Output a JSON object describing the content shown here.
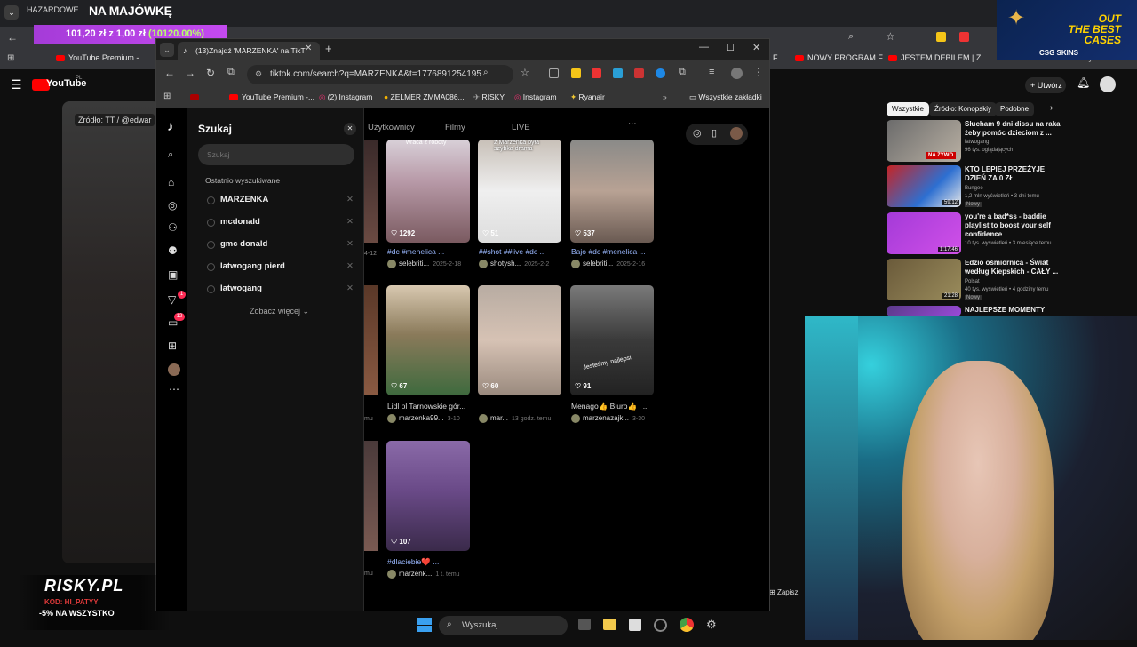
{
  "overlay": {
    "promo_title": "NA MAJÓWKĘ",
    "promo_odds_prefix": "101,20 zł",
    "promo_odds_mid": "z",
    "promo_odds_base": "1,00 zł",
    "promo_odds_pct": "(10120.00%)",
    "hazard_tab": "HAZARDOWE",
    "case_banner_line1": "OUT",
    "case_banner_line2": "THE BEST",
    "case_banner_line3": "CASES",
    "case_banner_brand": "CSG SKINS",
    "risky_logo": "RISKY.PL",
    "risky_code": "KOD: HI_PATYY",
    "risky_discount": "-5% NA WSZYSTKO"
  },
  "bg_browser": {
    "bookmarks": [
      "YouTube Premium -...",
      "F...",
      "NOWY PROGRAM F...",
      "JESTEM DEBILEM | Z...",
      "Wszystkie zakładki"
    ]
  },
  "youtube": {
    "logo": "YouTube",
    "logo_suffix": "PL",
    "source_label": "Źródło: TT / @edwar",
    "create_label": "Utwórz",
    "chips": [
      "Wszystkie",
      "Źródło: Konopskiy",
      "Podobne"
    ],
    "related": [
      {
        "title": "Słucham 9 dni dissu na raka żeby pomóc dzieciom z ...",
        "channel": "latwogang",
        "meta": "96 tys. oglądających",
        "badge": "NA ŻYWO"
      },
      {
        "title": "KTO LEPIEJ PRZEŻYJE DZIEŃ ZA 0 ZŁ",
        "channel": "Bungee",
        "meta": "1,2 mln wyświetleń • 3 dni temu",
        "duration": "59:12",
        "tag": "Nowy"
      },
      {
        "title": "you're a bad*ss - baddie playlist to boost your self confidence",
        "channel": "baddie femme",
        "meta": "10 tys. wyświetleń • 3 miesiące temu",
        "duration": "1:17:46"
      },
      {
        "title": "Edzio ośmiornica - Świat według Kiepskich - CAŁY ...",
        "channel": "Polsat",
        "meta": "40 tys. wyświetleń • 4 godziny temu",
        "duration": "21:28",
        "tag": "Nowy"
      },
      {
        "title": "NAJLEPSZE MOMENTY",
        "channel": "",
        "meta": "",
        "duration": ""
      }
    ],
    "save_label": "Zapisz"
  },
  "window": {
    "tab_title": "(13)Znajdź 'MARZENKA' na TikT",
    "url": "tiktok.com/search?q=MARZENKA&t=1776891254195",
    "bookmarks": [
      "YouTube Premium -...",
      "(2) Instagram",
      "ZELMER ZMMA086...",
      "RISKY",
      "Instagram",
      "Ryanair",
      "Wszystkie zakładki"
    ]
  },
  "tiktok": {
    "search_title": "Szukaj",
    "search_placeholder": "Szukaj",
    "recent_header": "Ostatnio wyszukiwane",
    "history": [
      "MARZENKA",
      "mcdonald",
      "gmc donald",
      "latwogang pierd",
      "latwogang"
    ],
    "see_more": "Zobacz więcej",
    "tabs": [
      "Użytkownicy",
      "Filmy",
      "LIVE"
    ],
    "badges": {
      "inbox": "1",
      "messages": "12"
    },
    "videos": [
      {
        "likes": "1292",
        "caption": "#dc #menelica ...",
        "author": "selebriti...",
        "date": "2025-2-18",
        "overlay": "wraca z roboty"
      },
      {
        "likes": "51",
        "caption": "##shot ##live #dc ...",
        "author": "shotysh...",
        "date": "2025-2-2",
        "overlay": "z Marzenka była szybka drama"
      },
      {
        "likes": "537",
        "caption": "Bajo #dc #menelica ...",
        "author": "selebriti...",
        "date": "2025-2-16",
        "overlay": ""
      },
      {
        "likes": "67",
        "caption": "Lidl pl Tarnowskie gór...",
        "author": "marzenka99...",
        "date": "3-10",
        "overlay": ""
      },
      {
        "likes": "60",
        "caption": "",
        "author": "mar...",
        "date": "13 godz. temu",
        "overlay": ""
      },
      {
        "likes": "91",
        "caption": "Menago👍 Biuro👍 i ...",
        "author": "marzenazajk...",
        "date": "3-30",
        "overlay": "Jesteśmy najlepsi"
      },
      {
        "likes": "107",
        "caption": "#dlaciebie❤️ ...",
        "author": "marzenk...",
        "date": "1 t. temu",
        "overlay": ""
      }
    ],
    "left_edge_texts": [
      "4-12",
      "mu",
      "mu"
    ]
  },
  "taskbar": {
    "search_label": "Wyszukaj"
  }
}
